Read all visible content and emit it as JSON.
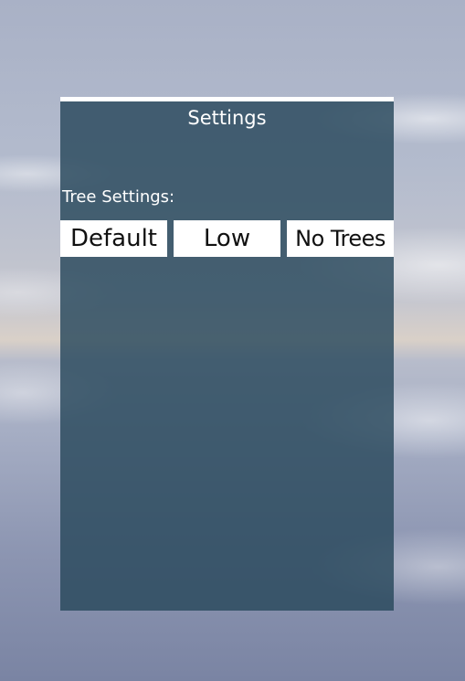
{
  "settings_panel": {
    "title": "Settings",
    "tree_settings": {
      "label": "Tree Settings:",
      "options": [
        "Default",
        "Low",
        "No Trees"
      ]
    }
  }
}
